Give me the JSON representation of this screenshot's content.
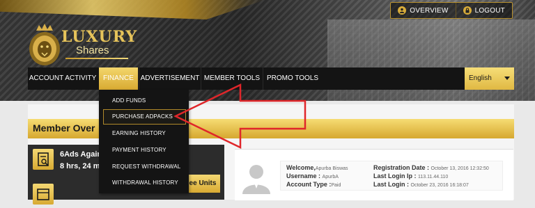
{
  "header": {
    "logo_line1": "LUXURY",
    "logo_line2": "Shares",
    "links": [
      {
        "label": "OVERVIEW",
        "icon": "user-icon"
      },
      {
        "label": "LOGOUT",
        "icon": "lock-icon"
      }
    ]
  },
  "nav": {
    "items": [
      {
        "label": "ACCOUNT ACTIVITY"
      },
      {
        "label": "FINANCE",
        "active": true
      },
      {
        "label": "ADVERTISEMENT"
      },
      {
        "label": "MEMBER TOOLS"
      },
      {
        "label": "PROMO TOOLS"
      }
    ],
    "language": "English"
  },
  "finance_menu": {
    "items": [
      {
        "label": "ADD FUNDS"
      },
      {
        "label": "PURCHASE ADPACKS",
        "highlighted": true
      },
      {
        "label": "EARNING HISTORY"
      },
      {
        "label": "PAYMENT HISTORY"
      },
      {
        "label": "REQUEST WITHDRAWAL"
      },
      {
        "label": "WITHDRAWAL HISTORY"
      }
    ]
  },
  "overview": {
    "title": "Member Over",
    "ads_line1": "6Ads Again",
    "ads_line2": "8 hrs, 24 m",
    "units_button": "ee Units"
  },
  "profile": {
    "welcome_label": "Welcome,",
    "welcome_value": "Apurba Biswas",
    "username_label": "Username :",
    "username_value": "ApurbA",
    "account_type_label": "Account Type :",
    "account_type_value": "Paid",
    "registration_label": "Registration Date :",
    "registration_value": "October 13, 2016 12:32:50",
    "last_ip_label": "Last Login Ip :",
    "last_ip_value": "113.11.44.110",
    "last_login_label": "Last Login :",
    "last_login_value": "October 23, 2016 16:18:07"
  },
  "colors": {
    "gold": "#d8aa32",
    "gold_light": "#f4d873",
    "nav_bg": "#141414",
    "annotation_arrow": "#e0262a"
  }
}
